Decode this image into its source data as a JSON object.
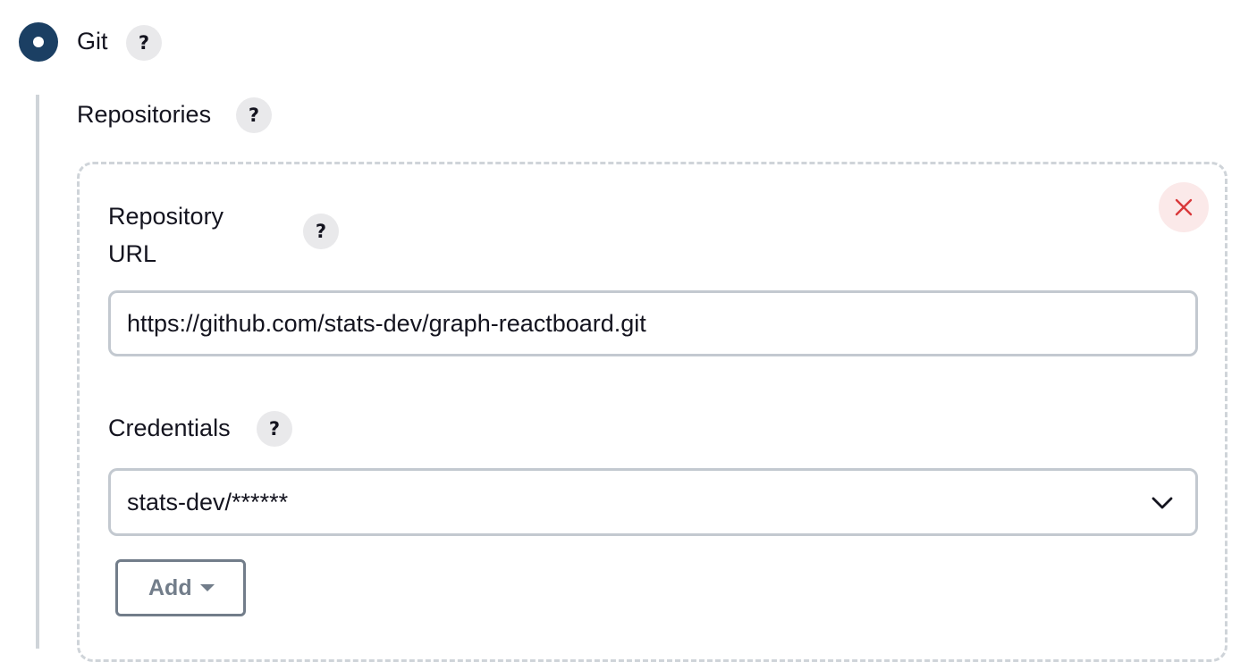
{
  "scm": {
    "option_label": "Git",
    "selected": true
  },
  "help_icon": "?",
  "repositories": {
    "label": "Repositories",
    "repository": {
      "url_label_line1": "Repository",
      "url_label_line2": "URL",
      "url_value": "https://github.com/stats-dev/graph-reactboard.git",
      "credentials_label": "Credentials",
      "credentials_value": "stats-dev/******",
      "add_button_label": "Add"
    }
  },
  "icons": {
    "radio": "radio-selected-icon",
    "help": "help-icon",
    "delete": "close-icon",
    "dropdown": "chevron-down-icon",
    "add_caret": "caret-down-icon"
  },
  "colors": {
    "radio_fill": "#1b3f63",
    "help_bg": "#e9e9eb",
    "delete_bg": "#fbe9e9",
    "delete_icon": "#d9383a",
    "input_border": "#c3c9d0",
    "add_button": "#727d8a",
    "dashed_border": "#cfd4d9"
  }
}
